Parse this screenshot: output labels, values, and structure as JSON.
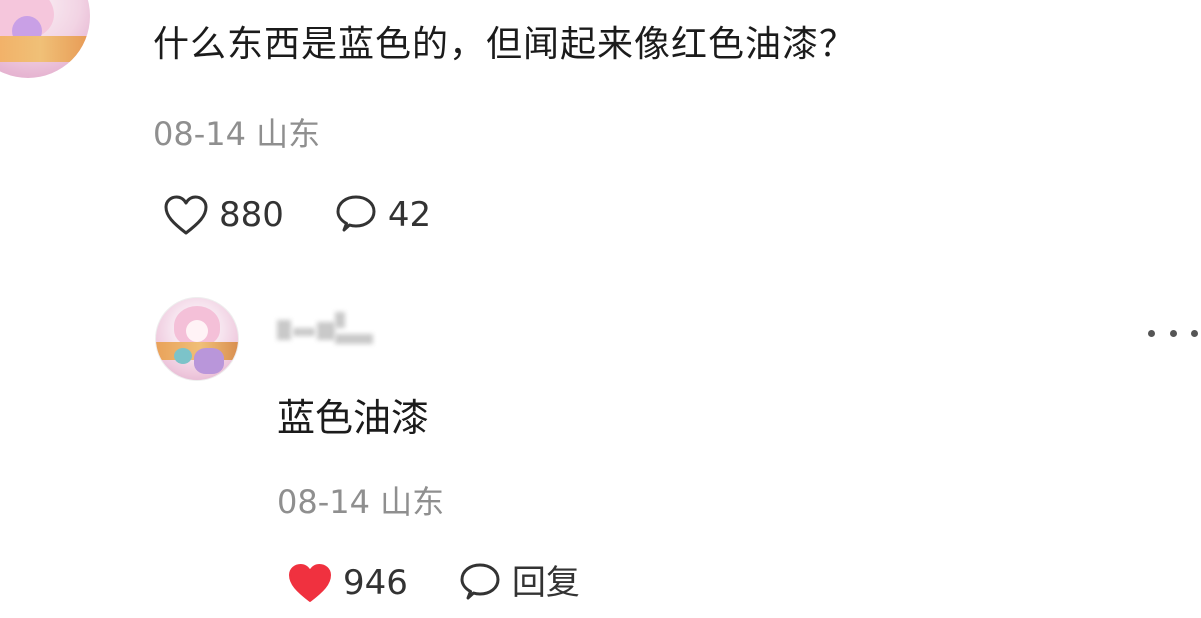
{
  "top_comment": {
    "text": "什么东西是蓝色的，但闻起来像红色油漆？",
    "date": "08-14",
    "location": "山东",
    "likes": "880",
    "comments": "42"
  },
  "reply": {
    "text": "蓝色油漆",
    "date": "08-14",
    "location": "山东",
    "likes": "946",
    "reply_label": "回复",
    "liked": true
  },
  "colors": {
    "liked_heart": "#f0313f",
    "meta_text": "#8f8f8f",
    "body_text": "#1b1b1b"
  },
  "icons": {
    "like": "heart-outline-icon",
    "liked": "heart-filled-icon",
    "comment": "speech-bubble-icon",
    "more": "more-horizontal-icon"
  }
}
